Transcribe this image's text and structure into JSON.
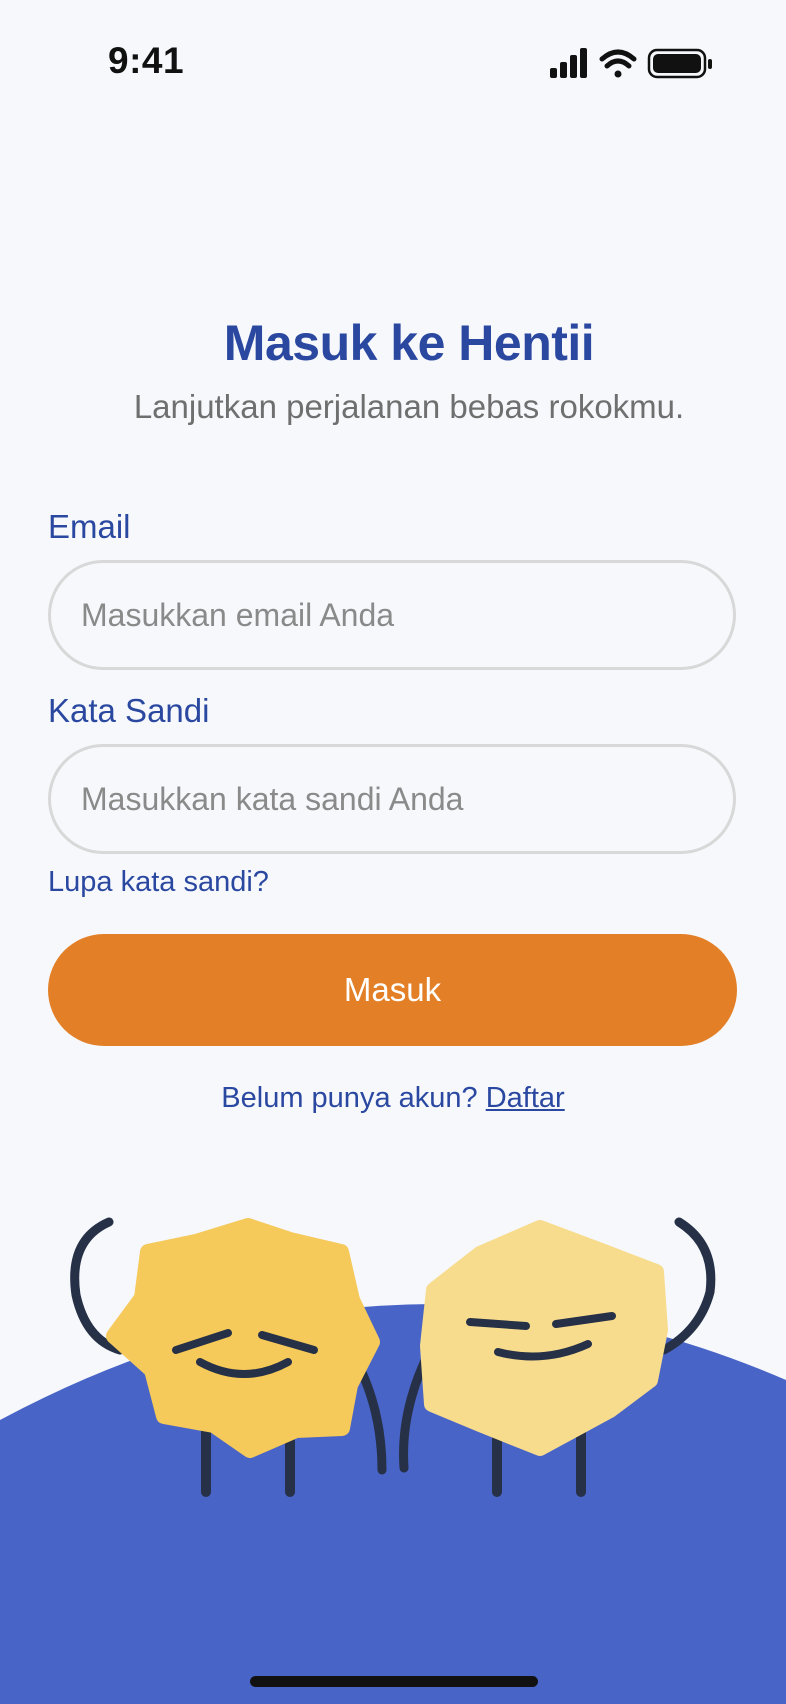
{
  "status_bar": {
    "time": "9:41",
    "icons": [
      "cellular-signal-icon",
      "wifi-icon",
      "battery-icon"
    ]
  },
  "header": {
    "title": "Masuk ke Hentii",
    "subtitle": "Lanjutkan perjalanan bebas rokokmu."
  },
  "form": {
    "email": {
      "label": "Email",
      "placeholder": "Masukkan email Anda",
      "value": ""
    },
    "password": {
      "label": "Kata Sandi",
      "placeholder": "Masukkan kata sandi Anda",
      "value": ""
    },
    "forgot_password": "Lupa kata sandi?",
    "submit_label": "Masuk"
  },
  "register": {
    "prompt": "Belum punya akun?",
    "link": "Daftar"
  },
  "colors": {
    "background": "#f6f8fc",
    "primary_text": "#2b48a1",
    "accent_button": "#e38027",
    "hill": "#4864c6",
    "mascot_left": "#f5c95a",
    "mascot_right": "#f8dc8e",
    "mascot_lines": "#263046"
  }
}
